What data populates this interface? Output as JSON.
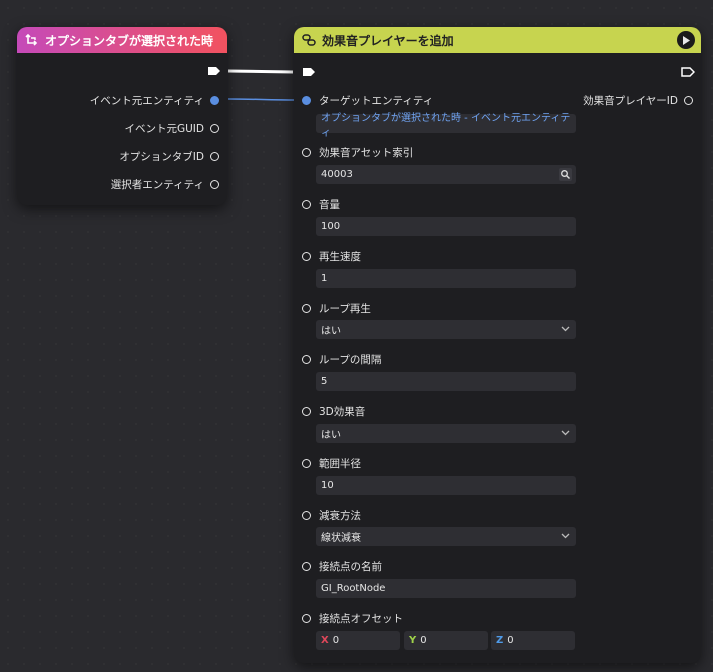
{
  "node_event": {
    "title": "オプションタブが選択された時",
    "outputs": [
      {
        "label": "イベント元エンティティ",
        "connected": true
      },
      {
        "label": "イベント元GUID",
        "connected": false
      },
      {
        "label": "オプションタブID",
        "connected": false
      },
      {
        "label": "選択者エンティティ",
        "connected": false
      }
    ]
  },
  "node_action": {
    "title": "効果音プレイヤーを追加",
    "output_label": "効果音プレイヤーID",
    "inputs": [
      {
        "label": "ターゲットエンティティ",
        "value": "オプションタブが選択された時 - イベント元エンティティ"
      },
      {
        "label": "効果音アセット索引",
        "value": "40003"
      },
      {
        "label": "音量",
        "value": "100"
      },
      {
        "label": "再生速度",
        "value": "1"
      },
      {
        "label": "ループ再生",
        "value": "はい"
      },
      {
        "label": "ループの間隔",
        "value": "5"
      },
      {
        "label": "3D効果音",
        "value": "はい"
      },
      {
        "label": "範囲半径",
        "value": "10"
      },
      {
        "label": "減衰方法",
        "value": "線状減衰"
      },
      {
        "label": "接続点の名前",
        "value": "GI_RootNode"
      },
      {
        "label": "接続点オフセット",
        "x_label": "X",
        "x": "0",
        "y_label": "Y",
        "y": "0",
        "z_label": "Z",
        "z": "0"
      }
    ]
  },
  "colors": {
    "event_header_start": "#c54ab9",
    "event_header_end": "#f2525f",
    "action_header": "#c7d44f",
    "link_pin": "#5a8ee0",
    "axis_x": "#e0475a",
    "axis_y": "#9fd24a",
    "axis_z": "#4f9ae8"
  }
}
